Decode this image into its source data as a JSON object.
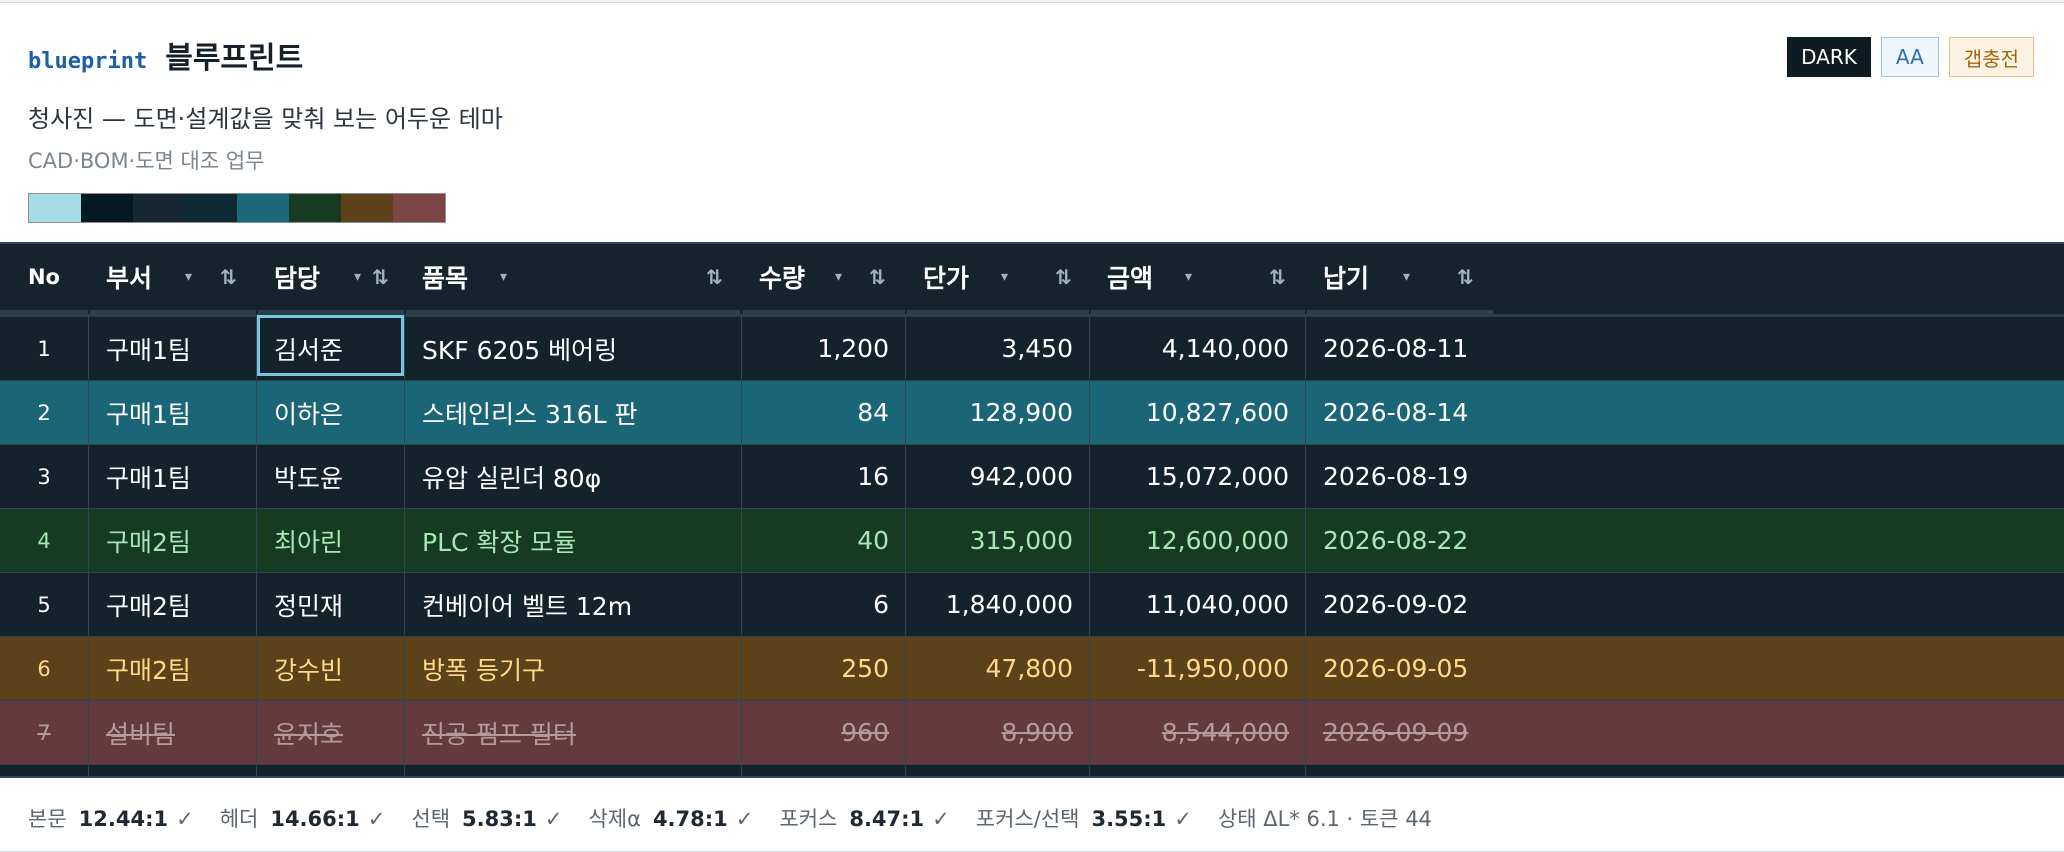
{
  "header": {
    "brand_mono": "blueprint",
    "title": "블루프린트",
    "subtitle": "청사진 — 도면·설계값을 맞춰 보는 어두운 테마",
    "note": "CAD·BOM·도면 대조 업무",
    "badges": {
      "dark": "DARK",
      "aa": "AA",
      "gap": "갭충전"
    },
    "swatches": [
      "#a6dbe6",
      "#041922",
      "#172633",
      "#0d2a36",
      "#1a6878",
      "#173a22",
      "#5d4219",
      "#7d4646"
    ]
  },
  "table": {
    "columns": {
      "no": "No",
      "dept": "부서",
      "owner": "담당",
      "item": "품목",
      "qty": "수량",
      "price": "단가",
      "amount": "금액",
      "due": "납기"
    },
    "sort_glyph": "⇅",
    "caret_glyph": "▾",
    "rows": [
      {
        "no": "1",
        "dept": "구매1팀",
        "owner": "김서준",
        "item": "SKF 6205 베어링",
        "qty": "1,200",
        "price": "3,450",
        "amount": "4,140,000",
        "due": "2026-08-11",
        "state": "focus"
      },
      {
        "no": "2",
        "dept": "구매1팀",
        "owner": "이하은",
        "item": "스테인리스 316L 판",
        "qty": "84",
        "price": "128,900",
        "amount": "10,827,600",
        "due": "2026-08-14",
        "state": "selected"
      },
      {
        "no": "3",
        "dept": "구매1팀",
        "owner": "박도윤",
        "item": "유압 실린더 80φ",
        "qty": "16",
        "price": "942,000",
        "amount": "15,072,000",
        "due": "2026-08-19",
        "state": "normal"
      },
      {
        "no": "4",
        "dept": "구매2팀",
        "owner": "최아린",
        "item": "PLC 확장 모듈",
        "qty": "40",
        "price": "315,000",
        "amount": "12,600,000",
        "due": "2026-08-22",
        "state": "success"
      },
      {
        "no": "5",
        "dept": "구매2팀",
        "owner": "정민재",
        "item": "컨베이어 벨트 12m",
        "qty": "6",
        "price": "1,840,000",
        "amount": "11,040,000",
        "due": "2026-09-02",
        "state": "normal"
      },
      {
        "no": "6",
        "dept": "구매2팀",
        "owner": "강수빈",
        "item": "방폭 등기구",
        "qty": "250",
        "price": "47,800",
        "amount": "-11,950,000",
        "due": "2026-09-05",
        "state": "warning"
      },
      {
        "no": "7",
        "dept": "설비팀",
        "owner": "윤지호",
        "item": "진공 펌프 필터",
        "qty": "960",
        "price": "8,900",
        "amount": "8,544,000",
        "due": "2026-09-09",
        "state": "deleted"
      }
    ]
  },
  "footer": [
    {
      "label": "본문",
      "value": "12.44:1",
      "mark": "✓"
    },
    {
      "label": "헤더",
      "value": "14.66:1",
      "mark": "✓"
    },
    {
      "label": "선택",
      "value": "5.83:1",
      "mark": "✓"
    },
    {
      "label": "삭제α",
      "value": "4.78:1",
      "mark": "✓"
    },
    {
      "label": "포커스",
      "value": "8.47:1",
      "mark": "✓"
    },
    {
      "label": "포커스/선택",
      "value": "3.55:1",
      "mark": "✓"
    }
  ],
  "footer_tail": "상태 ΔL* 6.1 · 토큰 44",
  "colors": {
    "grid_bg": "#14222c",
    "selected_bg": "#1b6676",
    "success_bg": "#173a22",
    "success_fg": "#a8e6b4",
    "warning_bg": "#5b4219",
    "warning_fg": "#ffd88a",
    "deleted_bg": "#633a3e",
    "deleted_fg": "#b59a9c",
    "focus_ring": "#76c8e0"
  }
}
